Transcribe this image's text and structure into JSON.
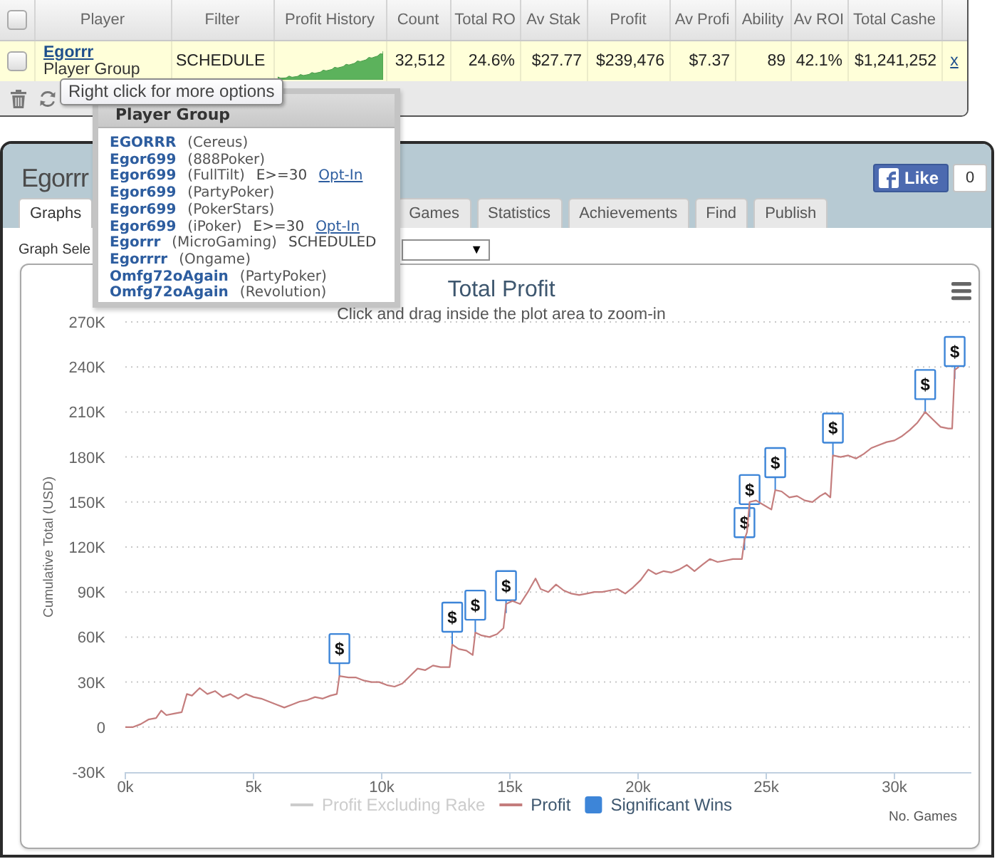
{
  "players_grid": {
    "select_all": {
      "checked": false
    },
    "columns": [
      "Player",
      "Filter",
      "Profit History",
      "Count",
      "Total RO",
      "Av Stak",
      "Profit",
      "Av Profi",
      "Ability",
      "Av ROI",
      "Total Cashe"
    ],
    "rows": [
      {
        "checked": false,
        "cells": [
          {
            "kind": "player",
            "link": "Egorrr",
            "text": "Player Group"
          },
          "SCHEDULE",
          {
            "kind": "sparkline"
          },
          "32,512",
          "24.6%",
          "$27.77",
          "$239,476",
          "$7.37",
          "89",
          "42.1%",
          "$1,241,252"
        ],
        "remove": "x"
      }
    ],
    "tooltip": "Right click for more options"
  },
  "player_group_popup": {
    "title": "Player Group",
    "accounts": [
      {
        "name": "EGORRR",
        "site": "(Cereus)"
      },
      {
        "name": "Egor699",
        "site": "(888Poker)"
      },
      {
        "name": "Egor699",
        "site": "(FullTilt)",
        "note": "E>=30",
        "link": "Opt-In"
      },
      {
        "name": "Egor699",
        "site": "(PartyPoker)"
      },
      {
        "name": "Egor699",
        "site": "(PokerStars)"
      },
      {
        "name": "Egor699",
        "site": "(iPoker)",
        "note": "E>=30",
        "link": "Opt-In"
      },
      {
        "name": "Egorrr",
        "site": "(MicroGaming)",
        "status": "SCHEDULED"
      },
      {
        "name": "Egorrrr",
        "site": "(Ongame)"
      },
      {
        "name": "Omfg72oAgain",
        "site": "(PartyPoker)"
      },
      {
        "name": "Omfg72oAgain",
        "site": "(Revolution)"
      }
    ]
  },
  "player_panel": {
    "title": "Egorrr",
    "like_button": "Like",
    "like_count": "0",
    "tabs": [
      {
        "label": "Graphs",
        "selected": true
      },
      {
        "label": "Games",
        "selected": false
      },
      {
        "label": "Statistics",
        "selected": false
      },
      {
        "label": "Achievements",
        "selected": false
      },
      {
        "label": "Find",
        "selected": false
      },
      {
        "label": "Publish",
        "selected": false
      }
    ],
    "graph_select": {
      "label": "Graph Sele",
      "caret": "▼"
    },
    "chart": {
      "subtitle": "Click and drag inside the plot area to zoom-in",
      "legend": [
        {
          "kind": "line",
          "label": "Profit Excluding Rake",
          "enabled": false
        },
        {
          "kind": "line",
          "label": "Profit",
          "enabled": true,
          "color": "#c47d7d"
        },
        {
          "kind": "flag",
          "label": "Significant Wins",
          "enabled": true,
          "color": "#3d85d8"
        }
      ],
      "chart_data": {
        "type": "line",
        "title": "Total Profit",
        "xlabel": "No. Games",
        "ylabel": "Cumulative Total (USD)",
        "grid": true,
        "xlim": [
          0,
          33000
        ],
        "ylim": [
          -30000,
          270000
        ],
        "xticks": [
          {
            "value": 0,
            "label": "0k"
          },
          {
            "value": 5000,
            "label": "5k"
          },
          {
            "value": 10000,
            "label": "10k"
          },
          {
            "value": 15000,
            "label": "15k"
          },
          {
            "value": 20000,
            "label": "20k"
          },
          {
            "value": 25000,
            "label": "25k"
          },
          {
            "value": 30000,
            "label": "30k"
          }
        ],
        "yticks": [
          {
            "value": -30000,
            "label": "-30K"
          },
          {
            "value": 0,
            "label": "0"
          },
          {
            "value": 30000,
            "label": "30K"
          },
          {
            "value": 60000,
            "label": "60K"
          },
          {
            "value": 90000,
            "label": "90K"
          },
          {
            "value": 120000,
            "label": "120K"
          },
          {
            "value": 150000,
            "label": "150K"
          },
          {
            "value": 180000,
            "label": "180K"
          },
          {
            "value": 210000,
            "label": "210K"
          },
          {
            "value": 240000,
            "label": "240K"
          },
          {
            "value": 270000,
            "label": "270K"
          }
        ],
        "x": [
          0,
          300,
          600,
          900,
          1200,
          1400,
          1600,
          1900,
          2200,
          2400,
          2600,
          2900,
          3200,
          3500,
          3800,
          4100,
          4400,
          4700,
          5000,
          5300,
          5600,
          5900,
          6200,
          6500,
          6800,
          7100,
          7400,
          7700,
          8000,
          8250,
          8350,
          8700,
          9000,
          9300,
          9600,
          9900,
          10200,
          10500,
          10800,
          11100,
          11400,
          11700,
          12000,
          12300,
          12650,
          12750,
          13000,
          13300,
          13550,
          13650,
          13900,
          14200,
          14500,
          14750,
          14850,
          15100,
          15400,
          15700,
          16000,
          16200,
          16500,
          16800,
          17100,
          17400,
          17700,
          18000,
          18300,
          18600,
          18900,
          19200,
          19500,
          19800,
          20100,
          20400,
          20700,
          21000,
          21300,
          21600,
          21900,
          22200,
          22500,
          22800,
          23100,
          23400,
          23700,
          24050,
          24150,
          24250,
          24350,
          24600,
          24900,
          25200,
          25350,
          25600,
          25900,
          26200,
          26500,
          26800,
          27100,
          27300,
          27500,
          27600,
          27900,
          28200,
          28500,
          28800,
          29100,
          29400,
          29700,
          30000,
          30300,
          30600,
          30900,
          31200,
          31500,
          31800,
          32100,
          32250,
          32350,
          32512
        ],
        "series": [
          {
            "color": "#c47d7d",
            "values": [
              0,
              0,
              2000,
              5000,
              6000,
              11000,
              8000,
              9000,
              10000,
              22000,
              21000,
              26000,
              22000,
              24000,
              20000,
              22000,
              19000,
              22000,
              20000,
              19000,
              17000,
              15000,
              13000,
              15000,
              17000,
              18000,
              20000,
              19000,
              21000,
              22000,
              34000,
              33000,
              33000,
              31000,
              30000,
              30000,
              28000,
              27000,
              29000,
              34000,
              39000,
              38000,
              41000,
              40000,
              40000,
              55000,
              52000,
              51000,
              48000,
              63000,
              61000,
              60000,
              62000,
              66000,
              82000,
              84000,
              82000,
              90000,
              99000,
              92000,
              90000,
              95000,
              91000,
              89000,
              88000,
              89000,
              90000,
              90000,
              91000,
              92000,
              89000,
              93000,
              98000,
              105000,
              102000,
              104000,
              103000,
              105000,
              108000,
              104000,
              108000,
              112000,
              110000,
              111000,
              112000,
              112000,
              125000,
              130000,
              150000,
              151000,
              148000,
              145000,
              158000,
              157000,
              153000,
              154000,
              151000,
              150000,
              154000,
              156000,
              153000,
              181000,
              180000,
              181000,
              179000,
              182000,
              186000,
              188000,
              190000,
              191000,
              194000,
              198000,
              203000,
              210000,
              205000,
              200000,
              199000,
              199000,
              238000,
              240000
            ]
          }
        ],
        "annotations": [
          {
            "x": 8350,
            "y": 34000,
            "text": "$"
          },
          {
            "x": 12750,
            "y": 55000,
            "text": "$"
          },
          {
            "x": 13650,
            "y": 63000,
            "text": "$"
          },
          {
            "x": 14850,
            "y": 76000,
            "text": "$"
          },
          {
            "x": 24150,
            "y": 118000,
            "text": "$"
          },
          {
            "x": 24350,
            "y": 140000,
            "text": "$"
          },
          {
            "x": 25350,
            "y": 158000,
            "text": "$"
          },
          {
            "x": 27600,
            "y": 181000,
            "text": "$"
          },
          {
            "x": 31200,
            "y": 210000,
            "text": "$"
          },
          {
            "x": 32350,
            "y": 232000,
            "text": "$"
          }
        ]
      }
    }
  }
}
